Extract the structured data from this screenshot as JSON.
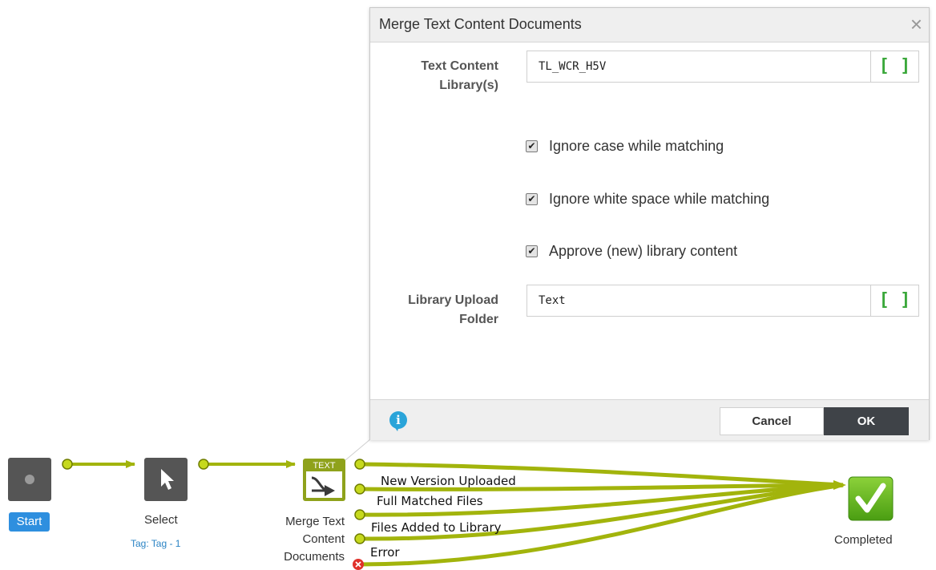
{
  "dialog": {
    "title": "Merge Text Content Documents",
    "close_glyph": "×",
    "library_label_1": "Text Content",
    "library_label_2": "Library(s)",
    "library_value": "TL_WCR_H5V",
    "library_var_glyph": "[ ]",
    "checkboxes": [
      {
        "label": "Ignore case while matching",
        "checked": true
      },
      {
        "label": "Ignore white space while matching",
        "checked": true
      },
      {
        "label": "Approve (new) library content",
        "checked": true
      }
    ],
    "folder_label_1": "Library Upload",
    "folder_label_2": "Folder",
    "folder_value": "Text",
    "folder_var_glyph": "[ ]",
    "info_glyph": "i",
    "cancel_label": "Cancel",
    "ok_label": "OK"
  },
  "flow": {
    "start": {
      "label": "Start",
      "icon": "stop-square-icon"
    },
    "select": {
      "label": "Select",
      "tag": "Tag: Tag - 1",
      "icon": "cursor-arrow-icon"
    },
    "merge": {
      "badge": "TEXT",
      "label_lines": [
        "Merge Text",
        "Content",
        "Documents"
      ],
      "icon": "merge-arrow-icon"
    },
    "completed": {
      "label": "Completed",
      "icon": "check-mark-icon"
    },
    "connections": [
      "New Version Uploaded",
      "Full Matched Files",
      "Files Added to Library",
      "Error"
    ]
  },
  "colors": {
    "connector_green": "#a2b40c",
    "connector_dark": "#6f7d00",
    "completed_green": "#61b31a",
    "node_dark": "#555555",
    "start_blue": "#2e8fdf",
    "error_red": "#e0312b",
    "variable_green": "#3ba83b"
  }
}
